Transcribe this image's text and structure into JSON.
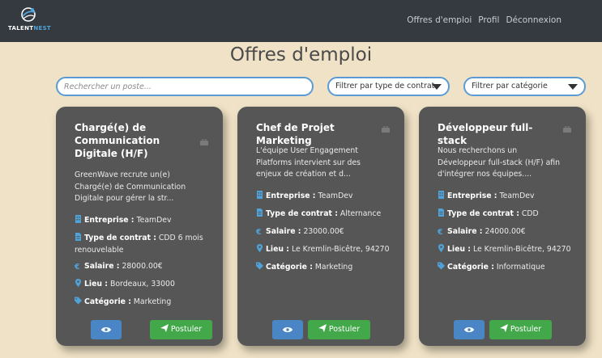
{
  "brand": {
    "name_a": "TALENT",
    "name_b": "NEST"
  },
  "nav": {
    "offres": "Offres d'emploi",
    "profil": "Profil",
    "deconnexion": "Déconnexion"
  },
  "page": {
    "title": "Offres d'emploi"
  },
  "filters": {
    "search_placeholder": "Rechercher un poste...",
    "contrat": "Filtrer par type de contrat",
    "categorie": "Filtrer par catégorie"
  },
  "labels": {
    "entreprise": "Entreprise :",
    "contrat": "Type de contrat :",
    "salaire": "Salaire :",
    "lieu": "Lieu :",
    "categorie": "Catégorie :",
    "postuler": "Postuler"
  },
  "jobs": [
    {
      "title": "Chargé(e) de Communication Digitale (H/F)",
      "description": "GreenWave recrute un(e) Chargé(e) de Communication Digitale pour gérer la str...",
      "entreprise": "TeamDev",
      "contrat": "CDD 6 mois renouvelable",
      "salaire": "28000.00€",
      "lieu": "Bordeaux, 33000",
      "categorie": "Marketing"
    },
    {
      "title": "Chef de Projet Marketing",
      "description": "L'équipe User Engagement Platforms intervient sur des enjeux de création et d...",
      "entreprise": "TeamDev",
      "contrat": "Alternance",
      "salaire": "23000.00€",
      "lieu": "Le Kremlin-Bicêtre, 94270",
      "categorie": "Marketing"
    },
    {
      "title": "Développeur full-stack",
      "description": "Nous recherchons un Développeur full-stack (H/F) afin d'intégrer nos équipes....",
      "entreprise": "TeamDev",
      "contrat": "CDD",
      "salaire": "24000.00€",
      "lieu": "Le Kremlin-Bicêtre, 94270",
      "categorie": "Informatique"
    }
  ]
}
